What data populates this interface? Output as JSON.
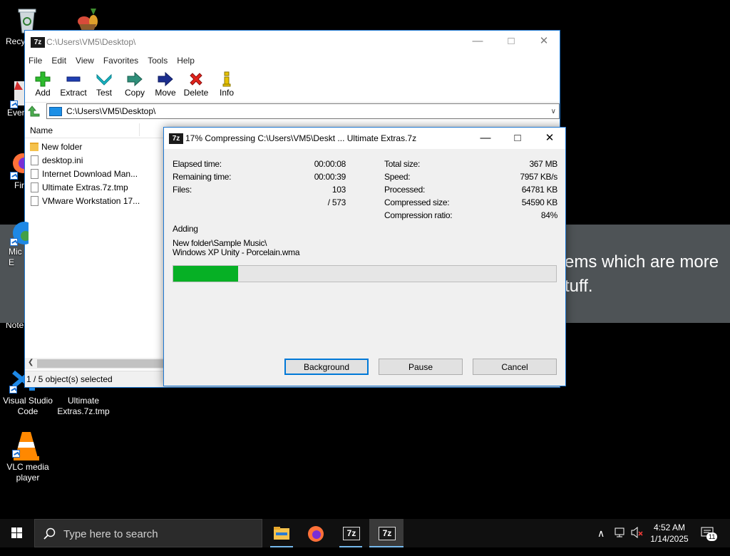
{
  "desktop": {
    "icons": [
      {
        "label": "Recy"
      },
      {
        "label": "Ever"
      },
      {
        "label": "Fir"
      },
      {
        "label": "Mic\nE"
      },
      {
        "label": "Note"
      },
      {
        "label": "Visual Studio\nCode"
      },
      {
        "label": "Ultimate\nExtras.7z.tmp"
      },
      {
        "label": "VLC media\nplayer"
      }
    ],
    "background_banner_text": "ems which are more\ntuff."
  },
  "main_window": {
    "app_icon_text": "7z",
    "title": "C:\\Users\\VM5\\Desktop\\",
    "menu": [
      "File",
      "Edit",
      "View",
      "Favorites",
      "Tools",
      "Help"
    ],
    "toolbar": [
      "Add",
      "Extract",
      "Test",
      "Copy",
      "Move",
      "Delete",
      "Info"
    ],
    "address": "C:\\Users\\VM5\\Desktop\\",
    "column_name": "Name",
    "files": [
      {
        "name": "New folder",
        "type": "folder"
      },
      {
        "name": "desktop.ini",
        "type": "file"
      },
      {
        "name": "Internet Download Man...",
        "type": "file"
      },
      {
        "name": "Ultimate Extras.7z.tmp",
        "type": "file"
      },
      {
        "name": "VMware Workstation 17...",
        "type": "file"
      }
    ],
    "status": "1 / 5 object(s) selected"
  },
  "progress_dialog": {
    "title": "17% Compressing C:\\Users\\VM5\\Deskt ... Ultimate Extras.7z",
    "percent": 17,
    "left": [
      {
        "label": "Elapsed time:",
        "value": "00:00:08"
      },
      {
        "label": "Remaining time:",
        "value": "00:00:39"
      },
      {
        "label": "Files:",
        "value": "103"
      },
      {
        "label": "",
        "value": "/ 573"
      }
    ],
    "right": [
      {
        "label": "Total size:",
        "value": "367 MB"
      },
      {
        "label": "Speed:",
        "value": "7957 KB/s"
      },
      {
        "label": "Processed:",
        "value": "64781 KB"
      },
      {
        "label": "Compressed size:",
        "value": "54590 KB"
      },
      {
        "label": "Compression ratio:",
        "value": "84%"
      }
    ],
    "action": "Adding",
    "current_path": "New folder\\Sample Music\\",
    "current_file": "Windows XP Unity - Porcelain.wma",
    "buttons": {
      "background": "Background",
      "pause": "Pause",
      "cancel": "Cancel"
    }
  },
  "taskbar": {
    "search_placeholder": "Type here to search",
    "app_7z_label": "7z",
    "time": "4:52 AM",
    "date": "1/14/2025",
    "notification_count": "11"
  },
  "colors": {
    "progress_fill": "#06b025",
    "window_border": "#1e78d2",
    "taskbar": "#101010"
  }
}
